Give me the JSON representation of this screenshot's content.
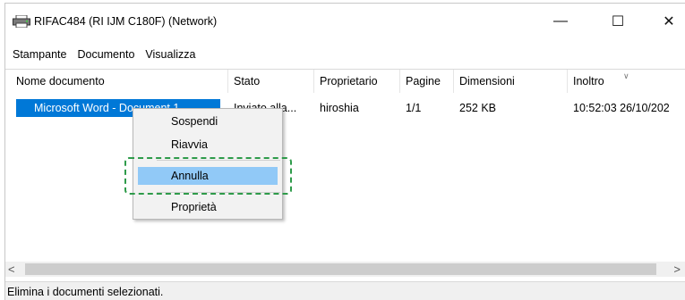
{
  "window": {
    "title": "RIFAC484 (RI IJM C180F) (Network)",
    "icon": "printer-icon",
    "minimize": "—",
    "maximize": "☐",
    "close": "✕"
  },
  "menubar": {
    "items": [
      "Stampante",
      "Documento",
      "Visualizza"
    ]
  },
  "columns": [
    "Nome documento",
    "Stato",
    "Proprietario",
    "Pagine",
    "Dimensioni",
    "Inoltro"
  ],
  "rows": [
    {
      "name": "Microsoft Word - Document 1",
      "status": "Inviato alla...",
      "owner": "hiroshia",
      "pages": "1/1",
      "size": "252 KB",
      "submitted": "10:52:03 26/10/202"
    }
  ],
  "context_menu": {
    "items": [
      "Sospendi",
      "Riavvia",
      "Annulla",
      "Proprietà"
    ],
    "highlighted": "Annulla"
  },
  "scrollbar": {
    "left_arrow": "<",
    "right_arrow": ">"
  },
  "status_bar": {
    "text": "Elimina i documenti selezionati."
  },
  "colors": {
    "selection": "#0078d7",
    "menu_highlight": "#91c9f7",
    "focus_outline": "#2e9b4a"
  }
}
